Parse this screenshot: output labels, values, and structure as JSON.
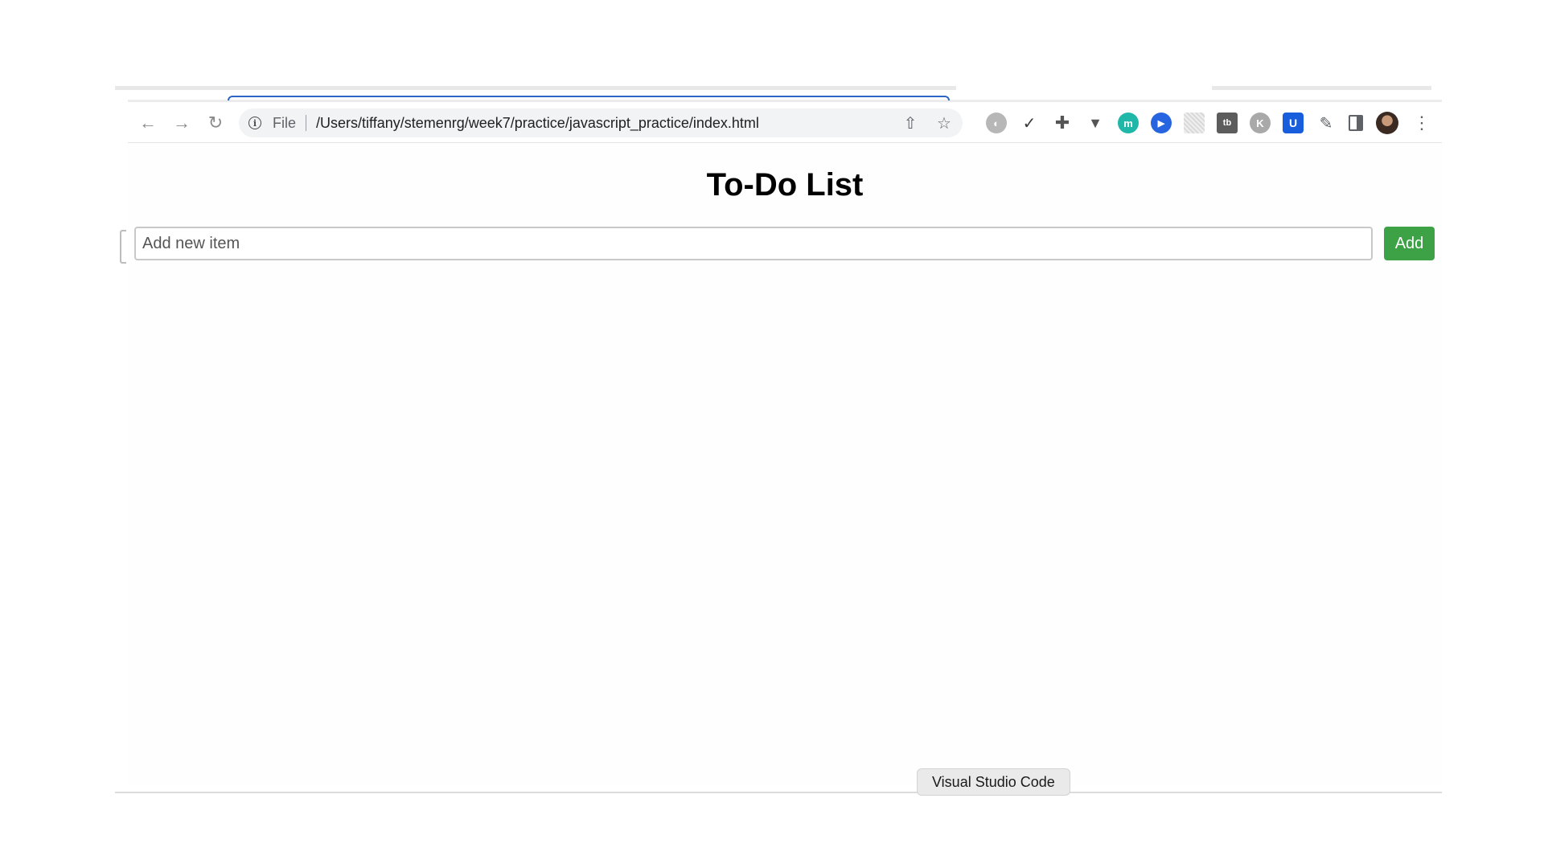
{
  "browser": {
    "scheme_label": "File",
    "url": "/Users/tiffany/stemenrg/week7/practice/javascript_practice/index.html"
  },
  "toolbar": {
    "back_icon": "arrow-left-icon",
    "forward_icon": "arrow-right-icon",
    "reload_icon": "reload-icon",
    "info_icon": "info-icon",
    "share_icon": "share-icon",
    "bookmark_icon": "star-icon",
    "extensions": [
      "grey-circle-extension-icon",
      "eyedropper-icon",
      "move-crosshair-icon",
      "vue-devtools-icon",
      "teal-m-extension-icon",
      "blue-circle-extension-icon",
      "grid-extension-icon",
      "tb-extension-icon",
      "k-extension-icon",
      "bitwarden-shield-icon",
      "puzzle-icon",
      "side-panel-icon"
    ],
    "ext_glyphs": {
      "teal": "m",
      "dark_square": "tb",
      "k_circle": "K",
      "shield": "U"
    },
    "menu_icon": "kebab-menu-icon"
  },
  "page": {
    "title": "To-Do List",
    "input_placeholder": "Add new item",
    "input_value": "",
    "add_label": "Add"
  },
  "dock": {
    "tooltip": "Visual Studio Code"
  },
  "colors": {
    "add_button": "#3da146",
    "active_tab_accent": "#2a64c5",
    "omnibox_bg": "#f1f3f4"
  }
}
